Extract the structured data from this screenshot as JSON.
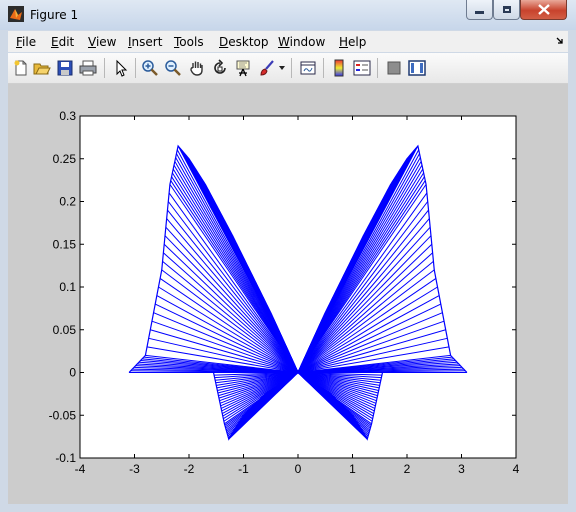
{
  "window": {
    "title": "Figure 1"
  },
  "menu": [
    "File",
    "Edit",
    "View",
    "Insert",
    "Tools",
    "Desktop",
    "Window",
    "Help"
  ],
  "toolbar_icons": [
    "new-figure-icon",
    "open-file-icon",
    "save-icon",
    "print-icon",
    "edit-plot-arrow-icon",
    "zoom-in-icon",
    "zoom-out-icon",
    "pan-hand-icon",
    "rotate-3d-icon",
    "data-cursor-icon",
    "brush-icon",
    "link-plot-icon",
    "insert-colorbar-icon",
    "insert-legend-icon",
    "hide-plot-tools-icon",
    "show-plot-tools-icon"
  ],
  "colors": {
    "line": "#0000ff",
    "axes_bg": "#ffffff",
    "figure_bg": "#cccccc"
  },
  "chart_data": {
    "type": "line",
    "title": "",
    "xlabel": "",
    "ylabel": "",
    "xlim": [
      -4,
      4
    ],
    "ylim": [
      -0.1,
      0.3
    ],
    "xticks": [
      "-4",
      "-3",
      "-2",
      "-1",
      "0",
      "1",
      "2",
      "3",
      "4"
    ],
    "yticks": [
      "-0.1",
      "-0.05",
      "0",
      "0.05",
      "0.1",
      "0.15",
      "0.2",
      "0.25",
      "0.3"
    ],
    "grid": false,
    "series": [
      {
        "description_points": "fan of line segments from origin to an upper curve",
        "x": [
          -3.1,
          -2.8,
          -2.5,
          -2.35,
          -2.2,
          -2.0,
          -1.7,
          -1.2,
          -0.5,
          0.0,
          0.5,
          1.2,
          1.7,
          2.0,
          2.2,
          2.35,
          2.5,
          2.8,
          3.1
        ],
        "y": [
          0.0,
          0.02,
          0.12,
          0.22,
          0.265,
          0.25,
          0.22,
          0.16,
          0.07,
          0.0,
          0.07,
          0.16,
          0.22,
          0.25,
          0.265,
          0.22,
          0.12,
          0.02,
          0.0
        ]
      },
      {
        "description_points": "fan of line segments from origin to a lower curve",
        "x": [
          -1.55,
          -1.45,
          -1.35,
          -1.27,
          -1.2,
          -1.0,
          -0.6,
          0.0,
          0.6,
          1.0,
          1.2,
          1.27,
          1.35,
          1.45,
          1.55
        ],
        "y": [
          0.0,
          -0.03,
          -0.06,
          -0.078,
          -0.07,
          -0.05,
          -0.025,
          0.0,
          -0.025,
          -0.05,
          -0.07,
          -0.078,
          -0.06,
          -0.03,
          0.0
        ]
      }
    ]
  }
}
